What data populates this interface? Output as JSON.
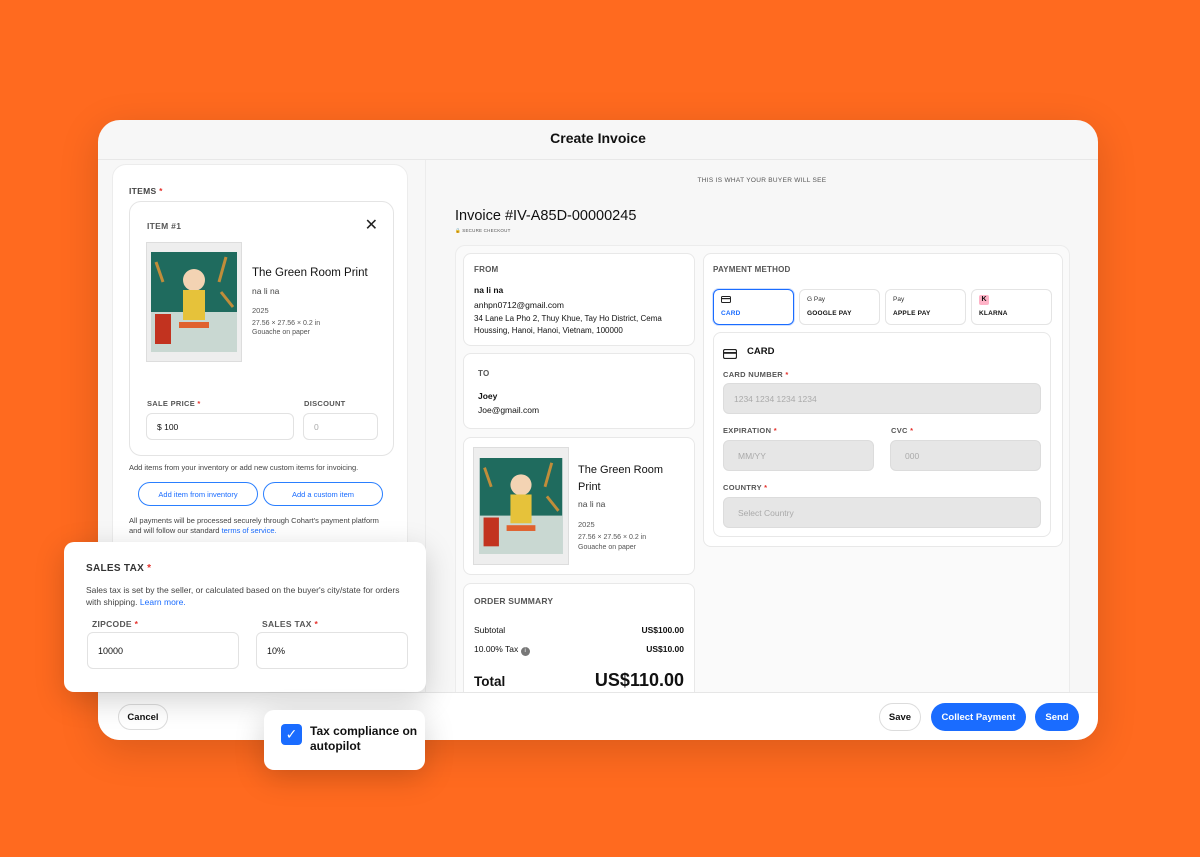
{
  "modal": {
    "title": "Create Invoice"
  },
  "items": {
    "label": "ITEMS",
    "required": "*",
    "item": {
      "number": "ITEM #1",
      "title": "The Green Room Print",
      "artist": "na li na",
      "year": "2025",
      "dimensions": "27.56 × 27.56 × 0.2 in",
      "medium": "Gouache on paper"
    },
    "sale_price_label": "SALE PRICE",
    "sale_price_value": "$ 100",
    "discount_label": "DISCOUNT",
    "discount_placeholder": "0",
    "hint": "Add items from your inventory or add new custom items for invoicing.",
    "add_inventory_label": "Add item from inventory",
    "add_custom_label": "Add a custom item",
    "payments_note_1": "All payments will be processed securely through Cohart's payment platform",
    "payments_note_2": "and will follow our standard",
    "terms_link": "terms of service."
  },
  "preview": {
    "buyer_note": "THIS IS WHAT YOUR BUYER WILL SEE",
    "invoice_title": "Invoice #IV-A85D-00000245",
    "secure_checkout": "SECURE CHECKOUT",
    "from": {
      "label": "FROM",
      "name": "na li na",
      "email": "anhpn0712@gmail.com",
      "address_1": "34 Lane La Pho 2, Thuy Khue, Tay Ho District, Cema",
      "address_2": "Houssing, Hanoi, Hanoi, Vietnam, 100000"
    },
    "to": {
      "label": "TO",
      "name": "Joey",
      "email": "Joe@gmail.com"
    },
    "item": {
      "title_1": "The Green Room",
      "title_2": "Print",
      "artist": "na li na",
      "year": "2025",
      "dimensions": "27.56 × 27.56 × 0.2 in",
      "medium": "Gouache on paper"
    },
    "summary": {
      "label": "ORDER SUMMARY",
      "subtotal_label": "Subtotal",
      "subtotal_value": "US$100.00",
      "tax_label": "10.00% Tax",
      "tax_value": "US$10.00",
      "total_label": "Total",
      "total_value": "US$110.00"
    },
    "payment": {
      "label": "PAYMENT METHOD",
      "options": [
        {
          "label": "CARD",
          "icon": "card-icon"
        },
        {
          "label": "GOOGLE PAY",
          "icon_text": "G Pay"
        },
        {
          "label": "APPLE PAY",
          "icon_text": " Pay"
        },
        {
          "label": "KLARNA",
          "icon_text": "K"
        }
      ],
      "card_title": "CARD",
      "card_number_label": "CARD NUMBER",
      "card_number_placeholder": "1234 1234 1234 1234",
      "expiration_label": "EXPIRATION",
      "expiration_placeholder": "MM/YY",
      "cvc_label": "CVC",
      "cvc_placeholder": "000",
      "country_label": "COUNTRY",
      "country_placeholder": "Select Country"
    }
  },
  "tax": {
    "title": "SALES TAX",
    "desc": "Sales tax is set by the seller, or calculated based on the buyer's city/state for orders with shipping.",
    "learn_more": "Learn more.",
    "zipcode_label": "ZIPCODE",
    "zipcode_value": "10000",
    "sales_tax_label": "SALES TAX",
    "sales_tax_value": "10%"
  },
  "footer": {
    "cancel": "Cancel",
    "save": "Save",
    "collect": "Collect Payment",
    "send": "Send"
  },
  "compliance": {
    "text": "Tax compliance on autopilot"
  },
  "colors": {
    "background": "#FF6A1F",
    "accent": "#1a6cff",
    "required": "#e5322d"
  }
}
